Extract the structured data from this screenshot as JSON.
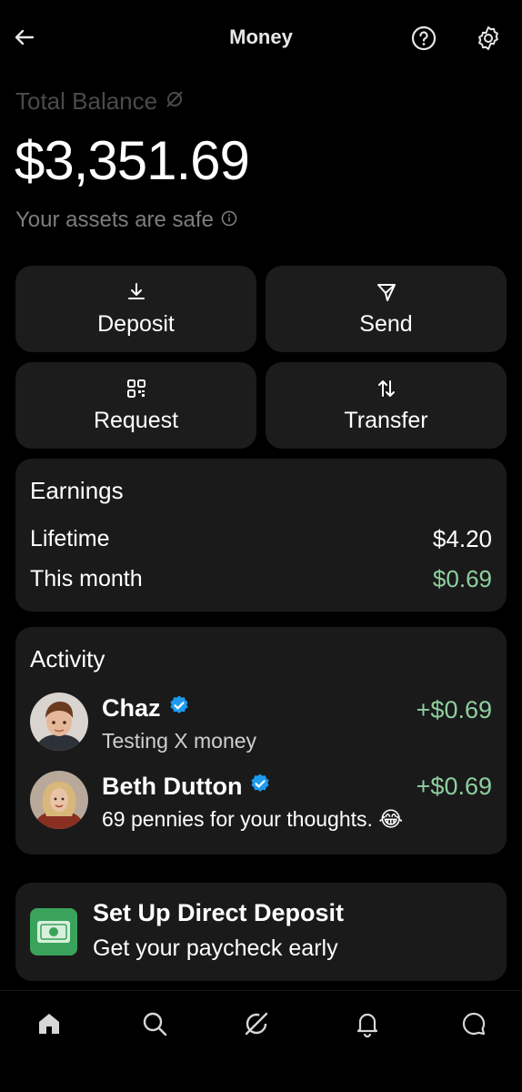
{
  "header": {
    "title": "Money",
    "back_icon": "arrow-left-icon",
    "help_icon": "question-circle-icon",
    "settings_icon": "gear-icon"
  },
  "balance": {
    "label": "Total Balance",
    "amount": "$3,351.69",
    "safe_note": "Your assets are safe"
  },
  "actions": [
    {
      "label": "Deposit",
      "icon": "download-icon"
    },
    {
      "label": "Send",
      "icon": "send-icon"
    },
    {
      "label": "Request",
      "icon": "qr-code-icon"
    },
    {
      "label": "Transfer",
      "icon": "swap-arrows-icon"
    }
  ],
  "earnings": {
    "title": "Earnings",
    "rows": [
      {
        "label": "Lifetime",
        "value": "$4.20"
      },
      {
        "label": "This month",
        "value": "$0.69"
      }
    ]
  },
  "activity": {
    "title": "Activity",
    "items": [
      {
        "name": "Chaz",
        "message": "Testing X money",
        "amount": "+$0.69"
      },
      {
        "name": "Beth Dutton",
        "message": "69 pennies for your thoughts. 😂",
        "amount": "+$0.69"
      }
    ]
  },
  "direct_deposit": {
    "title": "Set Up Direct Deposit",
    "subtitle": "Get your paycheck early"
  },
  "nav": [
    {
      "icon": "home-icon"
    },
    {
      "icon": "search-icon"
    },
    {
      "icon": "grok-icon"
    },
    {
      "icon": "bell-icon"
    },
    {
      "icon": "chat-bubble-icon"
    }
  ],
  "colors": {
    "positive": "#8ecfa0",
    "card": "#1a1a1a",
    "verified": "#1d9bf0"
  }
}
